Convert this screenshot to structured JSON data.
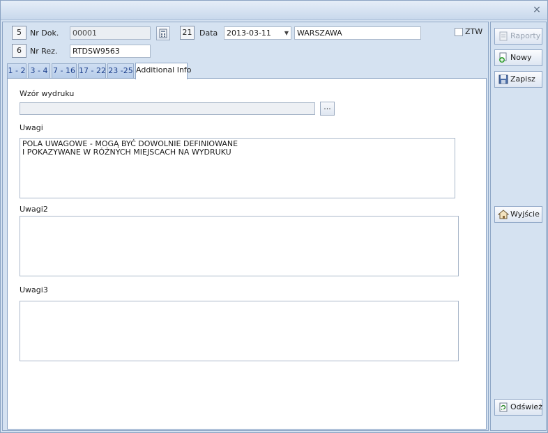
{
  "header": {
    "nr_dok": {
      "num": "5",
      "label": "Nr Dok.",
      "value": "00001"
    },
    "nr_rez": {
      "num": "6",
      "label": "Nr Rez.",
      "value": "RTDSW9563"
    },
    "data": {
      "num": "21",
      "label": "Data",
      "value": "2013-03-11"
    },
    "city": "WARSZAWA",
    "ztw_label": "ZTW"
  },
  "tabs": [
    {
      "label": "1 - 2"
    },
    {
      "label": "3 - 4"
    },
    {
      "label": "7 - 16"
    },
    {
      "label": "17 - 22"
    },
    {
      "label": "23 -25"
    },
    {
      "label": "Additional Info"
    }
  ],
  "content": {
    "wzor_label": "Wzór wydruku",
    "wzor_value": "",
    "dots_label": "...",
    "uwagi_label": "Uwagi",
    "uwagi_text": "POLA UWAGOWE - MOGĄ BYĆ DOWOLNIE DEFINIOWANE\nI POKAZYWANE W RÓŻNYCH MIEJSCACH NA WYDRUKU",
    "uwagi2_label": "Uwagi2",
    "uwagi2_text": "",
    "uwagi3_label": "Uwagi3",
    "uwagi3_text": ""
  },
  "sidebar": {
    "raporty": "Raporty",
    "nowy": "Nowy",
    "zapisz": "Zapisz",
    "wyjscie": "Wyjście",
    "odswiez": "Odśwież"
  },
  "titlebar": {
    "close": "×"
  }
}
